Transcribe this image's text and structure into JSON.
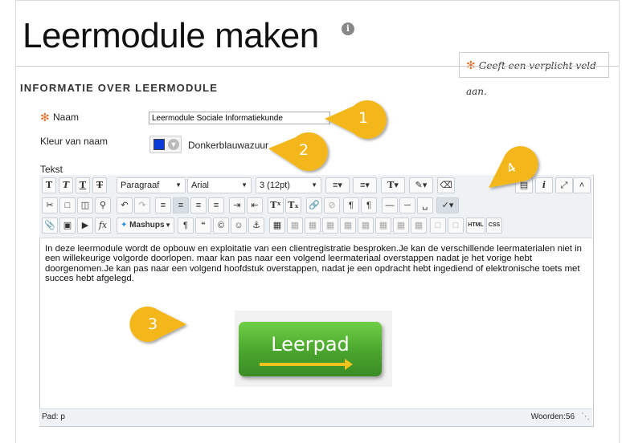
{
  "page": {
    "title": "Leermodule maken",
    "info_icon": "i",
    "required_note": "Geeft een verplicht veld aan.",
    "required_star": "✻",
    "section_heading": "INFORMATIE OVER LEERMODULE"
  },
  "form": {
    "name_label": "Naam",
    "name_value": "Leermodule Sociale Informatiekunde",
    "color_label": "Kleur van naam",
    "color_value": "Donkerblauwazuur",
    "color_hex": "#0a3bd6",
    "text_label": "Tekst"
  },
  "toolbar": {
    "format_select": "Paragraaf",
    "font_select": "Arial",
    "size_select": "3 (12pt)",
    "mashups_label": "Mashups",
    "html_label": "HTML",
    "css_label": "CSS"
  },
  "editor": {
    "content": "In deze leermodule wordt de opbouw en exploitatie van een clientregistratie besproken.Je kan de verschillende leermaterialen niet in een willekeurige volgorde doorlopen. maar kan pas naar een volgend leermateriaal overstappen nadat je het vorige hebt doorgenomen.Je kan pas naar een volgend hoofdstuk overstappen, nadat je een opdracht hebt ingediend of elektronische toets met succes hebt afgelegd.",
    "image_text": "Leerpad",
    "path_label": "Pad: p",
    "word_count": "Woorden:56"
  },
  "callouts": [
    "1",
    "2",
    "3",
    "4"
  ],
  "colors": {
    "accent": "#e8702a",
    "callout": "#f3b71a",
    "toolbar_bg": "#eef2f5"
  }
}
